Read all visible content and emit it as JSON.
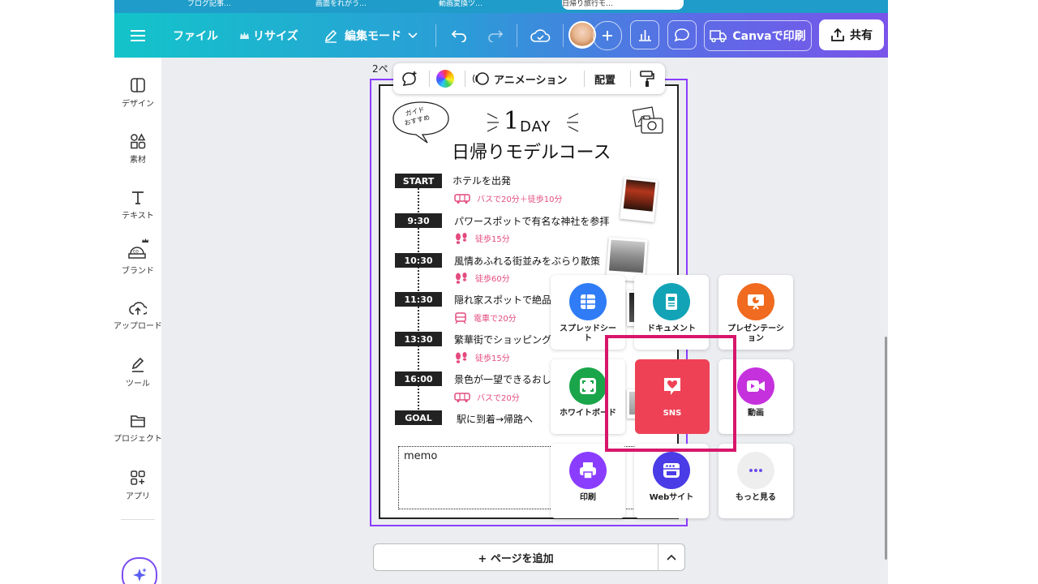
{
  "tabs": [
    {
      "label": "ブログ記事…"
    },
    {
      "label": "画面をれがう…"
    },
    {
      "label": "動画変換ツ…"
    },
    {
      "label": "日帰り旅行モ…"
    }
  ],
  "toolbar": {
    "file": "ファイル",
    "resize": "リサイズ",
    "edit_mode": "編集モード",
    "print": "Canvaで印刷",
    "share": "共有"
  },
  "sidebar": {
    "items": [
      {
        "label": "デザイン",
        "icon": "design-icon"
      },
      {
        "label": "素材",
        "icon": "elements-icon"
      },
      {
        "label": "テキスト",
        "icon": "text-icon"
      },
      {
        "label": "ブランド",
        "icon": "brand-icon"
      },
      {
        "label": "アップロード",
        "icon": "upload-icon"
      },
      {
        "label": "ツール",
        "icon": "tools-icon"
      },
      {
        "label": "プロジェクト",
        "icon": "projects-icon"
      },
      {
        "label": "アプリ",
        "icon": "apps-icon"
      }
    ]
  },
  "canvas": {
    "page_label": "2ペ",
    "context_toolbar": {
      "animation": "アニメーション",
      "position": "配置"
    },
    "add_page": "+ ページを追加"
  },
  "design": {
    "badge": "ガイド\nおすすめ",
    "headline_num": "1",
    "headline_day": "DAY",
    "title": "日帰りモデルコース",
    "schedule": [
      {
        "time": "START",
        "text": "ホテルを出発",
        "transport": "バスで20分＋徒歩10分"
      },
      {
        "time": "9:30",
        "text": "パワースポットで有名な神社を参拝",
        "transport": "徒歩15分"
      },
      {
        "time": "10:30",
        "text": "風情あふれる街並みをぶらり散策",
        "transport": "徒歩60分"
      },
      {
        "time": "11:30",
        "text": "隠れ家スポットで絶品",
        "transport": "電車で20分"
      },
      {
        "time": "13:30",
        "text": "繁華街でショッピング",
        "transport": "徒歩15分"
      },
      {
        "time": "16:00",
        "text": "景色が一望できるおし",
        "transport": "バスで20分"
      },
      {
        "time": "GOAL",
        "text": "駅に到着→帰路へ",
        "transport": ""
      }
    ],
    "memo": "memo"
  },
  "create_menu": {
    "items": [
      {
        "label": "スプレッドシー\nト",
        "icon": "spreadsheet-icon",
        "color": "#2f7cf6"
      },
      {
        "label": "ドキュメント",
        "icon": "document-icon",
        "color": "#12a4b6"
      },
      {
        "label": "プレゼンテーシ\nョン",
        "icon": "presentation-icon",
        "color": "#f06a1f"
      },
      {
        "label": "ホワイトボード",
        "icon": "whiteboard-icon",
        "color": "#1aa54a"
      },
      {
        "label": "SNS",
        "icon": "heart-chat-icon",
        "color": "#ef4156"
      },
      {
        "label": "動画",
        "icon": "video-icon",
        "color": "#c532dd"
      },
      {
        "label": "印刷",
        "icon": "printer-icon",
        "color": "#8b3dff"
      },
      {
        "label": "Webサイト",
        "icon": "website-icon",
        "color": "#4a3ce6"
      },
      {
        "label": "もっと見る",
        "icon": "more-dots-icon",
        "color": "#eeeeee"
      }
    ]
  }
}
